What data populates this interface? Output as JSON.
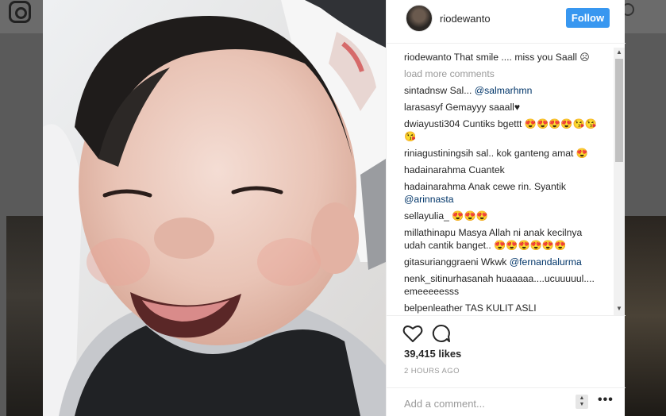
{
  "post": {
    "username": "riodewanto",
    "follow_label": "Follow",
    "caption": {
      "user": "riodewanto",
      "text": "That smile .... miss you Saall ☹"
    },
    "load_more_label": "load more comments",
    "comments": [
      {
        "user": "sintadnsw",
        "text": "Sal... ",
        "mention": "@salmarhmn"
      },
      {
        "user": "larasasyf",
        "text": "Gemayyy saaall♥",
        "mention": ""
      },
      {
        "user": "dwiayusti304",
        "text": "Cuntiks bgettt 😍😍😍😍😘😘😘",
        "mention": ""
      },
      {
        "user": "riniagustiningsih",
        "text": "sal.. kok ganteng amat 😍",
        "mention": ""
      },
      {
        "user": "hadainarahma",
        "text": "Cuantek",
        "mention": ""
      },
      {
        "user": "hadainarahma",
        "text": "Anak cewe rin. Syantik ",
        "mention": "@arinnasta"
      },
      {
        "user": "sellayulia_",
        "text": "😍😍😍",
        "mention": ""
      },
      {
        "user": "millathinapu",
        "text": "Masya Allah ni anak kecilnya udah cantik banget.. 😍😍😍😍😍😍",
        "mention": ""
      },
      {
        "user": "gitasurianggraeni",
        "text": "Wkwk ",
        "mention": "@fernandalurma"
      },
      {
        "user": "nenk_sitinurhasanah",
        "text": "huaaaaa....ucuuuuul.... emeeeeesss",
        "mention": ""
      },
      {
        "user": "belpenleather",
        "text": "TAS KULIT ASLI",
        "mention": ""
      }
    ],
    "likes": "39,415 likes",
    "time": "2 HOURS AGO",
    "comment_placeholder": "Add a comment...",
    "more_label": "•••"
  },
  "icons": {
    "heart": "heart-icon",
    "comment": "comment-icon",
    "logo": "instagram-logo-icon"
  },
  "colors": {
    "follow_bg": "#3897f0",
    "mention": "#003569",
    "muted": "#999999"
  }
}
